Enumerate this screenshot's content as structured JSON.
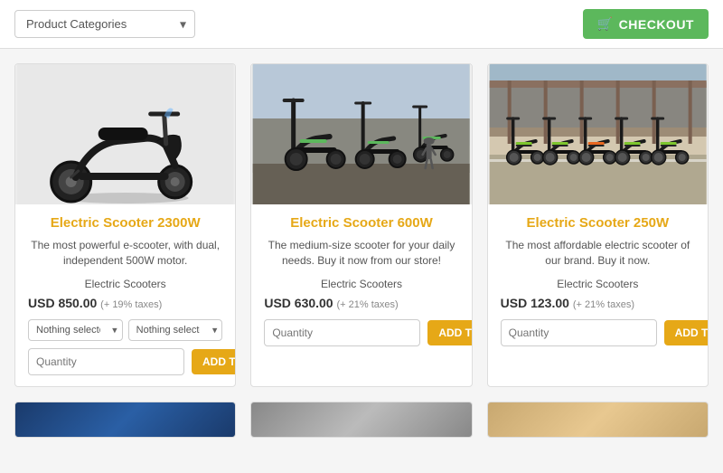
{
  "toolbar": {
    "category_placeholder": "Product Categories",
    "checkout_label": "CHECKOUT",
    "checkout_icon": "🛒"
  },
  "products": [
    {
      "id": "scooter-2300w",
      "name": "Electric Scooter 2300W",
      "description": "The most powerful e-scooter, with dual, independent 500W motor.",
      "category": "Electric Scooters",
      "price": "USD 850.00",
      "tax": "(+ 19% taxes)",
      "option1_placeholder": "Nothing selected",
      "option2_placeholder": "Nothing selected",
      "quantity_placeholder": "Quantity",
      "add_to_cart_label": "ADD TO CART",
      "img_color": "#d0d0d0"
    },
    {
      "id": "scooter-600w",
      "name": "Electric Scooter 600W",
      "description": "The medium-size scooter for your daily needs. Buy it now from our store!",
      "category": "Electric Scooters",
      "price": "USD 630.00",
      "tax": "(+ 21% taxes)",
      "option1_placeholder": null,
      "option2_placeholder": null,
      "quantity_placeholder": "Quantity",
      "add_to_cart_label": "ADD TO CART",
      "img_color": "#7aaa88"
    },
    {
      "id": "scooter-250w",
      "name": "Electric Scooter 250W",
      "description": "The most affordable electric scooter of our brand. Buy it now.",
      "category": "Electric Scooters",
      "price": "USD 123.00",
      "tax": "(+ 21% taxes)",
      "option1_placeholder": null,
      "option2_placeholder": null,
      "quantity_placeholder": "Quantity",
      "add_to_cart_label": "ADD TO CART",
      "img_color": "#88aabb"
    }
  ],
  "bottom_cards": [
    {
      "id": "card1",
      "color": "blue"
    },
    {
      "id": "card2",
      "color": "gray"
    },
    {
      "id": "card3",
      "color": "tan"
    }
  ]
}
